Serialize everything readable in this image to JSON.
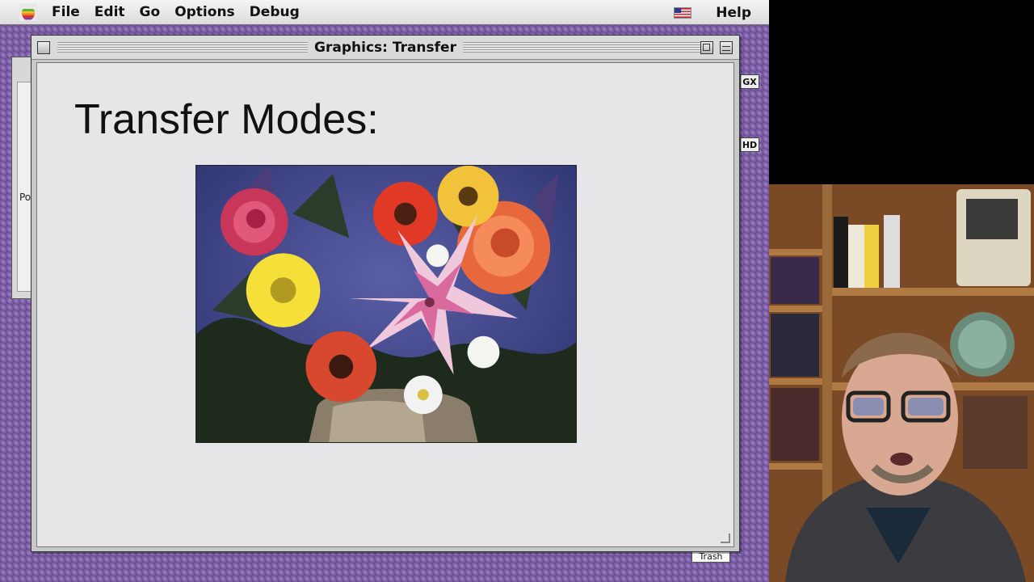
{
  "menubar": {
    "apple_menu_icon": "apple-icon",
    "items": [
      "File",
      "Edit",
      "Go",
      "Options",
      "Debug"
    ],
    "keyboard_flag_icon": "us-flag-icon",
    "help_label": "Help"
  },
  "left_window": {
    "visible_text": "Po"
  },
  "desktop_icons": {
    "gx_label": "GX",
    "hd_label": "HD",
    "trash_label": "Trash"
  },
  "window": {
    "title": "Graphics: Transfer",
    "heading": "Transfer Modes:",
    "image_subject": "flower-bouquet-photo"
  },
  "colors": {
    "desktop_purple": "#7a5aa6",
    "window_gray": "#c9c9c9",
    "content_bg": "#e6e6e8"
  }
}
